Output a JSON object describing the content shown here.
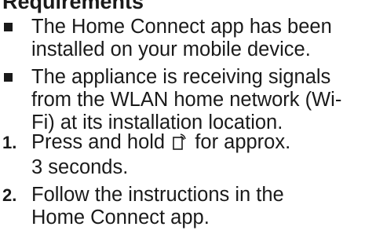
{
  "heading": "Requirements",
  "requirements": [
    {
      "line1": "The Home Connect app has been",
      "line2": "installed on your mobile device."
    },
    {
      "line1": "The appliance is receiving signals",
      "line2": "from the WLAN home network (Wi-",
      "line3": "Fi) at its installation location."
    }
  ],
  "steps": [
    {
      "number": "1.",
      "text_before_icon": "Press and hold",
      "icon": "remote-start-icon",
      "text_after_icon": "for approx.",
      "line2": "3 seconds."
    },
    {
      "number": "2.",
      "line1": "Follow the instructions in the",
      "line2": "Home Connect app."
    }
  ]
}
